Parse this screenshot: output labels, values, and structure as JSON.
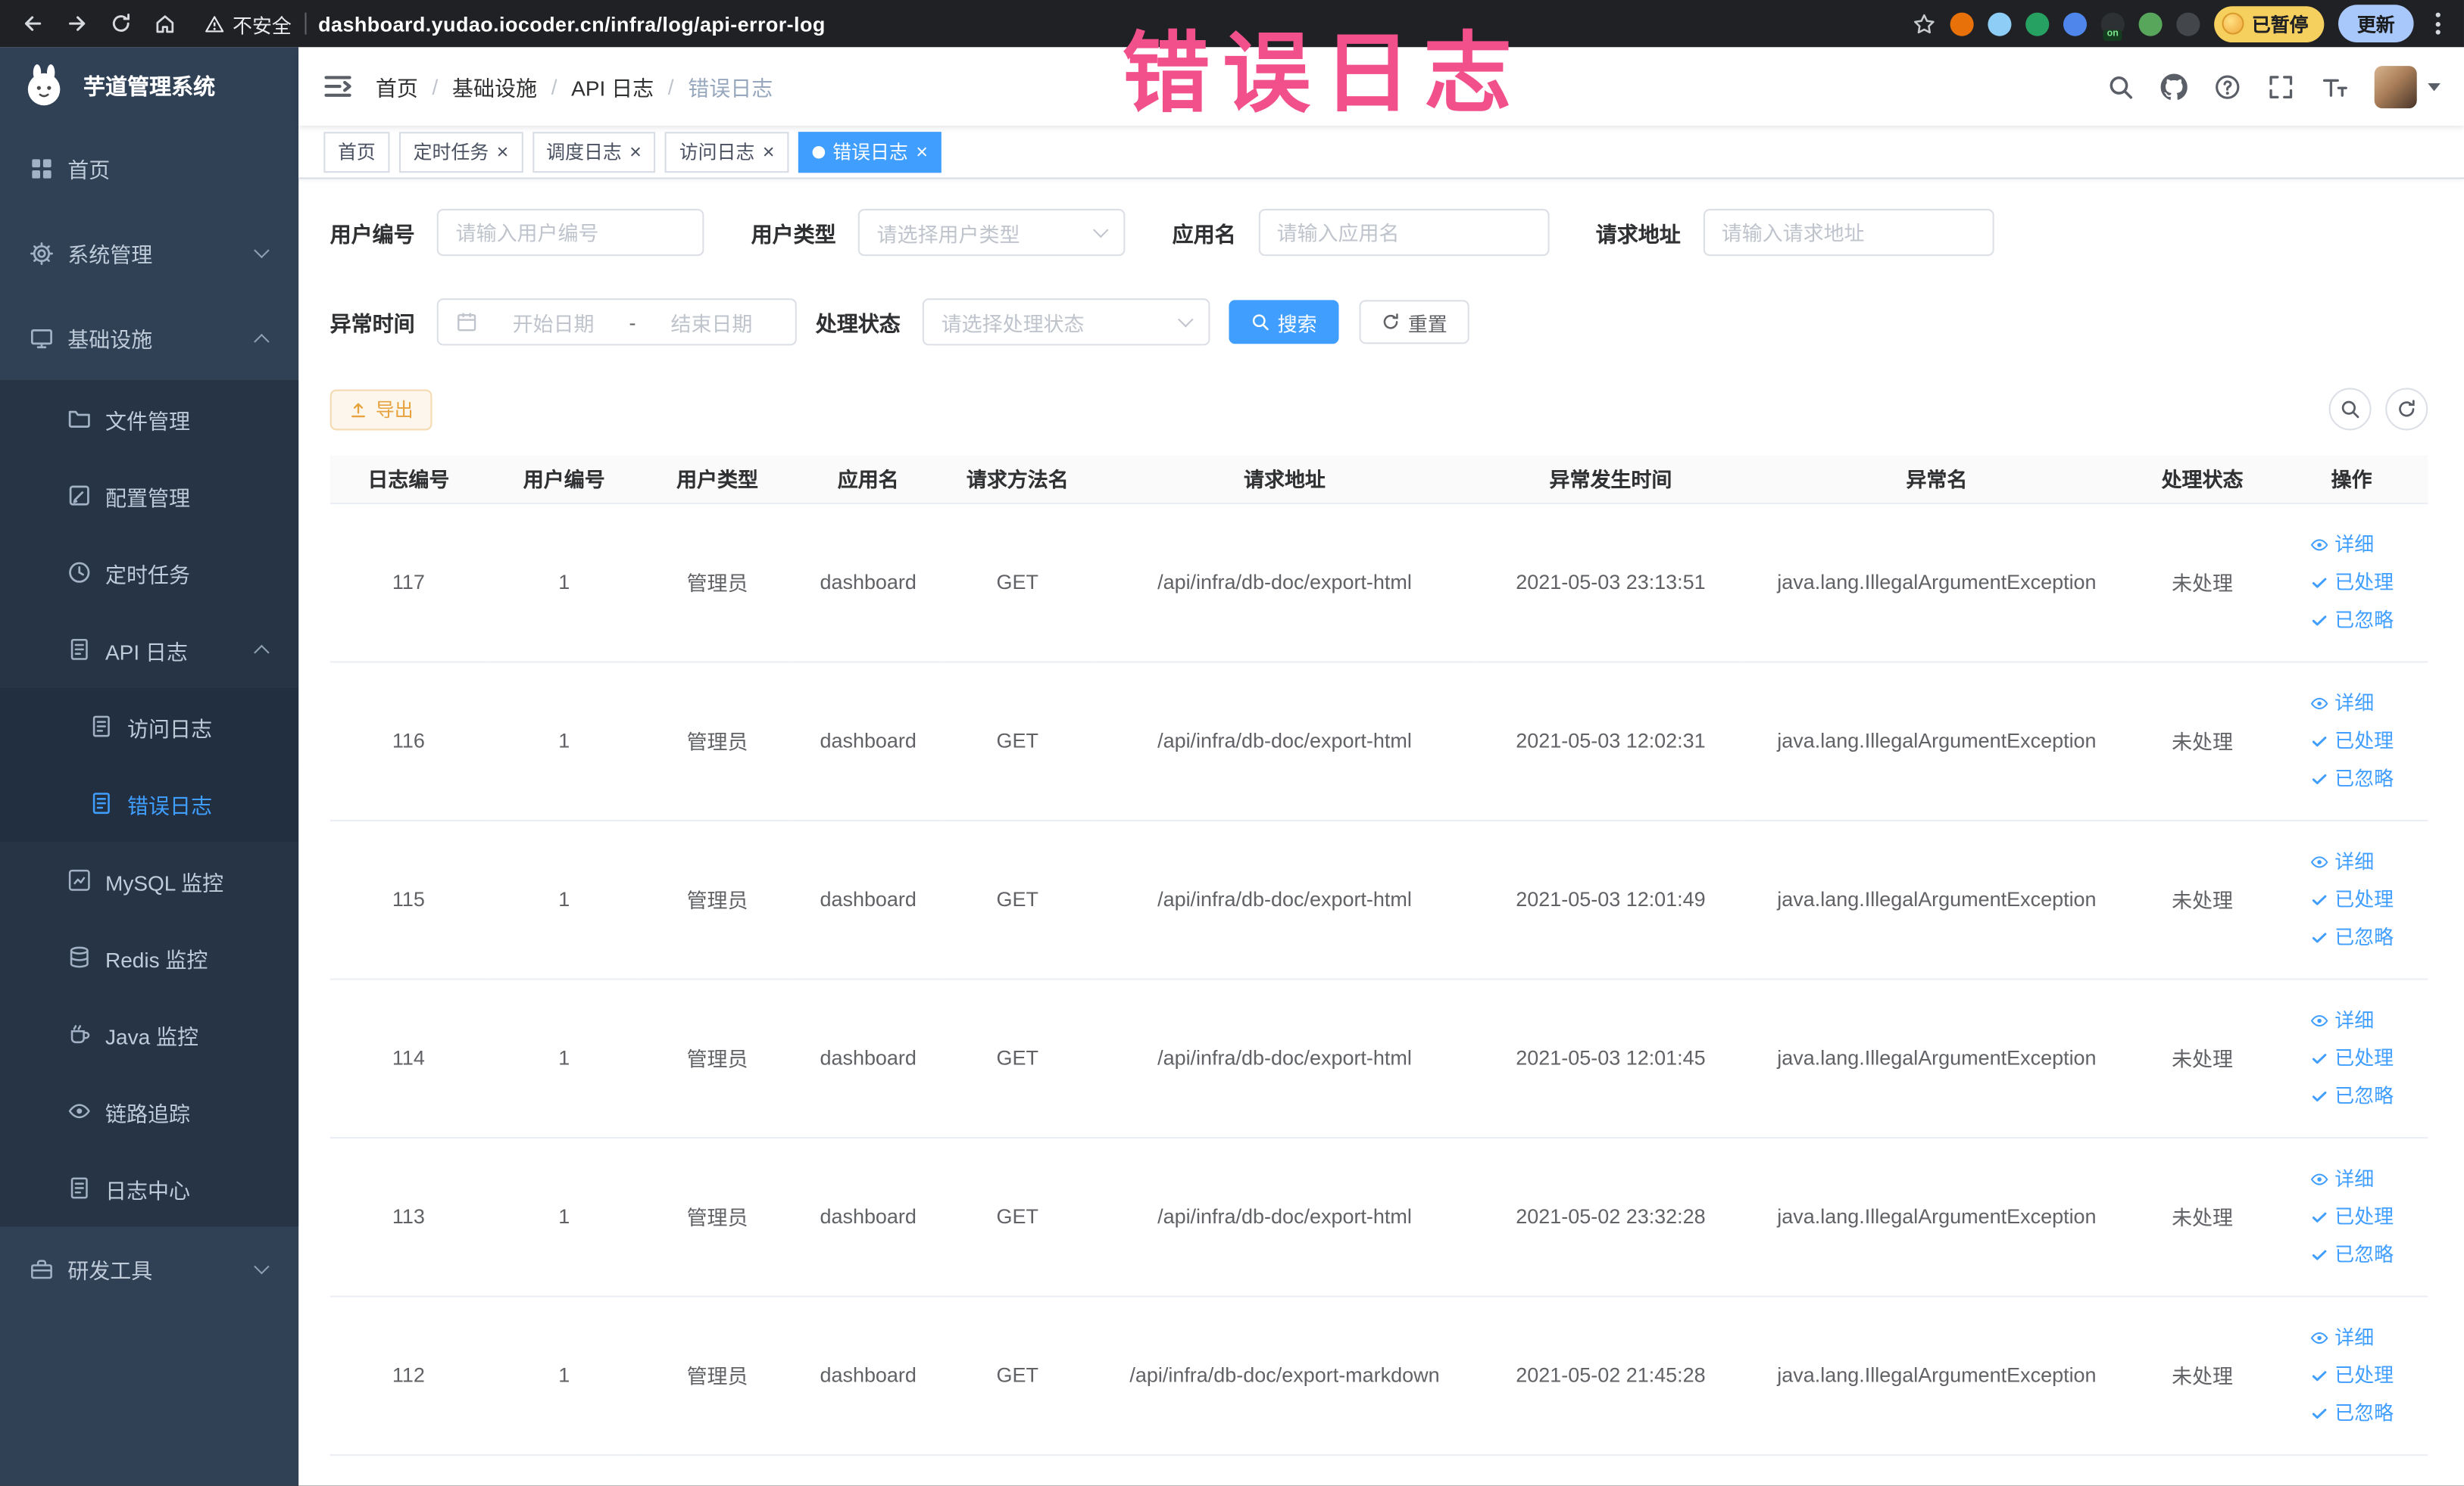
{
  "colors": {
    "accent": "#409eff",
    "annotation": "#f2508a",
    "warning": "#e6a23c",
    "sidebar_bg": "#304156",
    "active_tab": "#409eff"
  },
  "annotation": {
    "text": "错误日志",
    "color": "#f2508a"
  },
  "browser": {
    "nav_icons": [
      "back",
      "forward",
      "reload",
      "home"
    ],
    "security_label": "不安全",
    "url": "dashboard.yudao.iocoder.cn/infra/log/api-error-log",
    "extensions": [
      {
        "color": "#e8710a"
      },
      {
        "color": "#8ecdf5"
      },
      {
        "color": "#27a162"
      },
      {
        "color": "#4f86ec"
      },
      {
        "color": "#2e3134",
        "label": "on"
      },
      {
        "color": "#57a65c"
      },
      {
        "color": "#43464a"
      }
    ],
    "paused_badge": "已暂停",
    "update_button": "更新"
  },
  "sidebar": {
    "title": "芋道管理系统",
    "menu": [
      {
        "id": "home",
        "label": "首页",
        "icon": "dashboard",
        "level": 1
      },
      {
        "id": "system",
        "label": "系统管理",
        "icon": "gear",
        "level": 1,
        "arrow": "down"
      },
      {
        "id": "infra",
        "label": "基础设施",
        "icon": "monitor",
        "level": 1,
        "arrow": "up"
      },
      {
        "id": "file",
        "label": "文件管理",
        "icon": "folder",
        "level": 2
      },
      {
        "id": "config",
        "label": "配置管理",
        "icon": "edit",
        "level": 2
      },
      {
        "id": "job",
        "label": "定时任务",
        "icon": "clock",
        "level": 2
      },
      {
        "id": "api-log",
        "label": "API 日志",
        "icon": "document",
        "level": 2,
        "arrow": "up"
      },
      {
        "id": "access-log",
        "label": "访问日志",
        "icon": "document",
        "level": 3
      },
      {
        "id": "error-log",
        "label": "错误日志",
        "icon": "document",
        "level": 3,
        "active": true
      },
      {
        "id": "mysql",
        "label": "MySQL 监控",
        "icon": "chart",
        "level": 2
      },
      {
        "id": "redis",
        "label": "Redis 监控",
        "icon": "database",
        "level": 2
      },
      {
        "id": "java",
        "label": "Java 监控",
        "icon": "coffee",
        "level": 2
      },
      {
        "id": "trace",
        "label": "链路追踪",
        "icon": "eye",
        "level": 2
      },
      {
        "id": "log-center",
        "label": "日志中心",
        "icon": "document",
        "level": 2
      },
      {
        "id": "dev-tools",
        "label": "研发工具",
        "icon": "toolbox",
        "level": 1,
        "arrow": "down"
      }
    ]
  },
  "navbar": {
    "breadcrumb": [
      {
        "label": "首页"
      },
      {
        "label": "基础设施"
      },
      {
        "label": "API 日志"
      },
      {
        "label": "错误日志",
        "current": true
      }
    ],
    "icons": [
      "search",
      "github",
      "help",
      "fullscreen",
      "fontsize"
    ]
  },
  "tabs": [
    {
      "label": "首页"
    },
    {
      "label": "定时任务",
      "closable": true
    },
    {
      "label": "调度日志",
      "closable": true
    },
    {
      "label": "访问日志",
      "closable": true
    },
    {
      "label": "错误日志",
      "closable": true,
      "active": true
    }
  ],
  "filters": {
    "user_id": {
      "label": "用户编号",
      "placeholder": "请输入用户编号"
    },
    "user_type": {
      "label": "用户类型",
      "placeholder": "请选择用户类型"
    },
    "app_name": {
      "label": "应用名",
      "placeholder": "请输入应用名"
    },
    "request_url": {
      "label": "请求地址",
      "placeholder": "请输入请求地址"
    },
    "exception_time": {
      "label": "异常时间",
      "start_placeholder": "开始日期",
      "separator": "-",
      "end_placeholder": "结束日期"
    },
    "process_status": {
      "label": "处理状态",
      "placeholder": "请选择处理状态"
    },
    "search_label": "搜索",
    "reset_label": "重置"
  },
  "toolbar": {
    "export_label": "导出"
  },
  "table": {
    "columns": [
      "日志编号",
      "用户编号",
      "用户类型",
      "应用名",
      "请求方法名",
      "请求地址",
      "异常发生时间",
      "异常名",
      "处理状态",
      "操作"
    ],
    "row_actions": [
      {
        "id": "detail",
        "label": "详细",
        "icon": "eye"
      },
      {
        "id": "processed",
        "label": "已处理",
        "icon": "check"
      },
      {
        "id": "ignored",
        "label": "已忽略",
        "icon": "check"
      }
    ],
    "rows": [
      [
        "117",
        "1",
        "管理员",
        "dashboard",
        "GET",
        "/api/infra/db-doc/export-html",
        "2021-05-03 23:13:51",
        "java.lang.IllegalArgumentException",
        "未处理"
      ],
      [
        "116",
        "1",
        "管理员",
        "dashboard",
        "GET",
        "/api/infra/db-doc/export-html",
        "2021-05-03 12:02:31",
        "java.lang.IllegalArgumentException",
        "未处理"
      ],
      [
        "115",
        "1",
        "管理员",
        "dashboard",
        "GET",
        "/api/infra/db-doc/export-html",
        "2021-05-03 12:01:49",
        "java.lang.IllegalArgumentException",
        "未处理"
      ],
      [
        "114",
        "1",
        "管理员",
        "dashboard",
        "GET",
        "/api/infra/db-doc/export-html",
        "2021-05-03 12:01:45",
        "java.lang.IllegalArgumentException",
        "未处理"
      ],
      [
        "113",
        "1",
        "管理员",
        "dashboard",
        "GET",
        "/api/infra/db-doc/export-html",
        "2021-05-02 23:32:28",
        "java.lang.IllegalArgumentException",
        "未处理"
      ],
      [
        "112",
        "1",
        "管理员",
        "dashboard",
        "GET",
        "/api/infra/db-doc/export-markdown",
        "2021-05-02 21:45:28",
        "java.lang.IllegalArgumentException",
        "未处理"
      ]
    ]
  }
}
